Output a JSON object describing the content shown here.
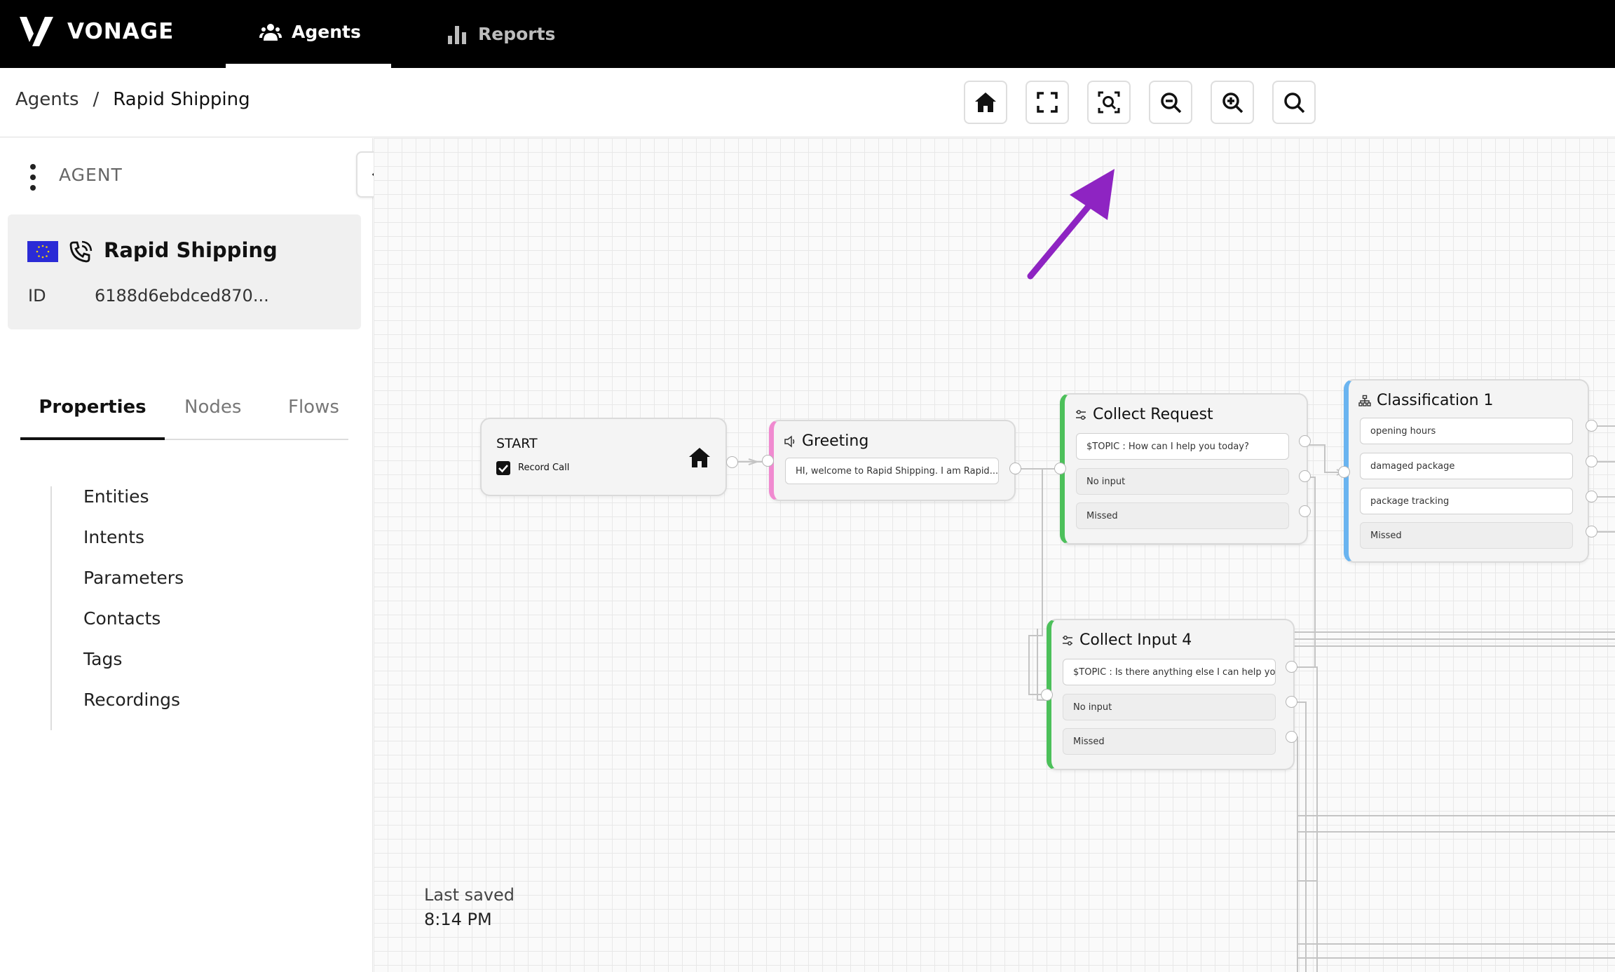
{
  "brand": {
    "name": "VONAGE"
  },
  "nav": {
    "agents_label": "Agents",
    "reports_label": "Reports"
  },
  "breadcrumb": {
    "root": "Agents",
    "separator": "/",
    "current": "Rapid Shipping"
  },
  "toolbar": {
    "buttons": [
      "home-icon",
      "fullscreen-icon",
      "zoom-fit-icon",
      "zoom-out-icon",
      "zoom-in-icon",
      "search-icon"
    ]
  },
  "sidebar": {
    "heading": "AGENT",
    "agent": {
      "name": "Rapid Shipping",
      "id_label": "ID",
      "id_value": "6188d6ebdced870..."
    },
    "tabs": {
      "properties": "Properties",
      "nodes": "Nodes",
      "flows": "Flows"
    },
    "properties": [
      "Entities",
      "Intents",
      "Parameters",
      "Contacts",
      "Tags",
      "Recordings"
    ]
  },
  "canvas": {
    "start": {
      "title": "START",
      "record_call": "Record Call"
    },
    "greeting": {
      "title": "Greeting",
      "message": "HI, welcome to Rapid Shipping. I am Rapid..."
    },
    "collect_request": {
      "title": "Collect Request",
      "prompt": "$TOPIC : How can I help you today?",
      "no_input": "No input",
      "missed": "Missed"
    },
    "classification": {
      "title": "Classification 1",
      "options": [
        "opening hours",
        "damaged package",
        "package tracking"
      ],
      "missed": "Missed"
    },
    "collect_input": {
      "title": "Collect Input 4",
      "prompt": "$TOPIC : Is there anything else I can help you with?",
      "no_input": "No input",
      "missed": "Missed"
    }
  },
  "status": {
    "last_saved_label": "Last saved",
    "last_saved_time": "8:14 PM"
  },
  "colors": {
    "greeting_accent": "#f08ad0",
    "collect_accent": "#4cc05a",
    "classification_accent": "#6ab4f0",
    "annotation_arrow": "#8e24c2"
  }
}
